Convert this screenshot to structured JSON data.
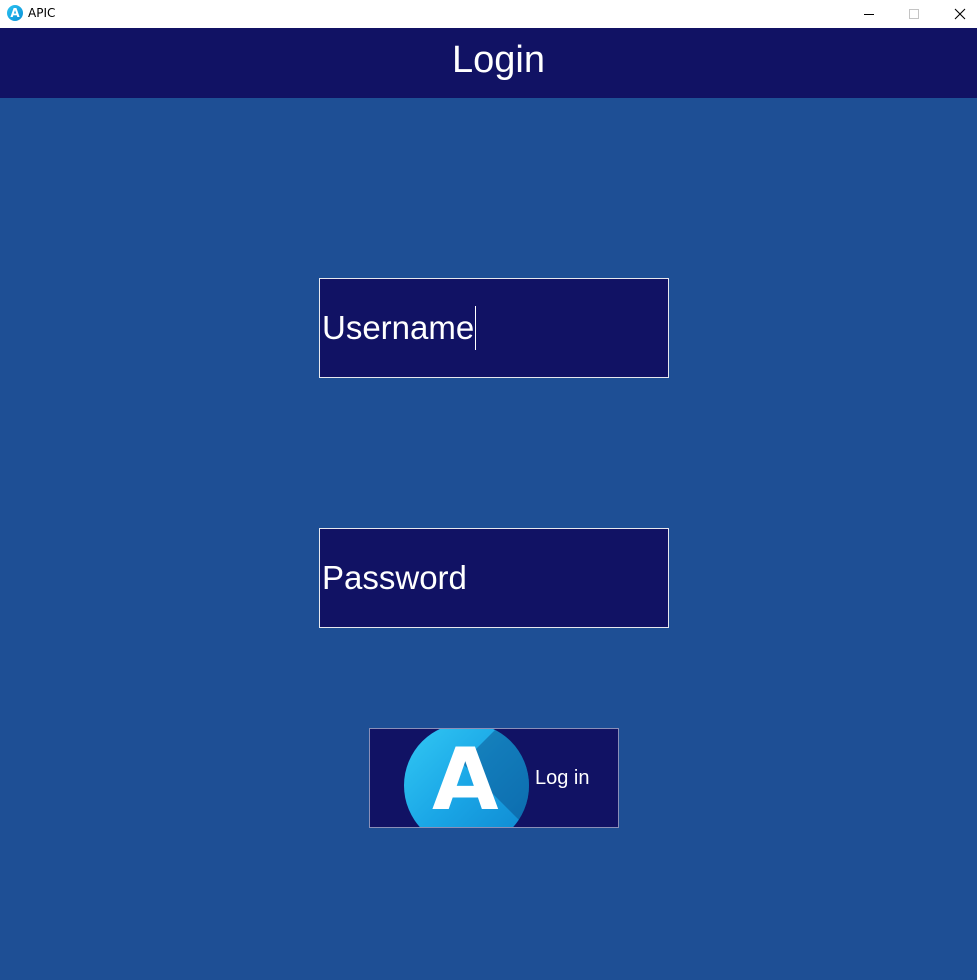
{
  "window": {
    "app_icon_letter": "A",
    "title": "APIC"
  },
  "header": {
    "title": "Login"
  },
  "form": {
    "username_value": "Username",
    "password_value": "Password",
    "login_button_label": "Log in",
    "logo_letter": "A"
  },
  "colors": {
    "background": "#1e4f95",
    "header": "#111264",
    "field_bg": "#111264",
    "logo_accent": "#1aa6e6"
  }
}
